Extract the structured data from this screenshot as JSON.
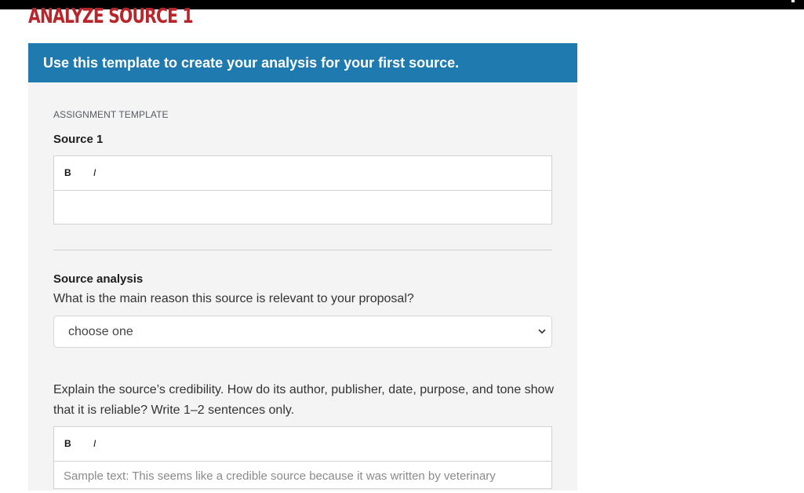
{
  "page": {
    "title": "ANALYZE SOURCE 1",
    "banner": "Use this template to create your analysis for your first source."
  },
  "template": {
    "eyebrow": "ASSIGNMENT TEMPLATE",
    "source": {
      "label": "Source 1",
      "toolbar": {
        "bold": "B",
        "italic": "I"
      },
      "value": ""
    },
    "analysis": {
      "label": "Source analysis",
      "question": "What is the main reason this source is relevant to your proposal?",
      "select_value": "choose one"
    },
    "credibility": {
      "question": "Explain the source’s credibility. How do its author, publisher, date, purpose, and tone show that it is reliable? Write 1–2 sentences only.",
      "toolbar": {
        "bold": "B",
        "italic": "I"
      },
      "placeholder": "Sample text: This seems like a credible source because it was written by veterinary"
    }
  },
  "colors": {
    "title": "#b8262b",
    "banner": "#1f7ab0",
    "panel": "#f4f4f4"
  }
}
